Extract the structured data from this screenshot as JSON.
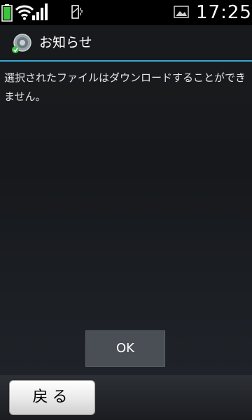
{
  "status_bar": {
    "time": "17:25",
    "icons": [
      "battery-icon",
      "wifi-icon",
      "signal-icon",
      "vibrate-icon",
      "image-notify-icon"
    ]
  },
  "dialog": {
    "title": "お知らせ",
    "icon": "notice-icon",
    "message": "選択されたファイルはダウンロードすることができません。",
    "ok_label": "OK",
    "accent_color": "#37a8d8"
  },
  "bottom_bar": {
    "back_label": "戻る"
  }
}
